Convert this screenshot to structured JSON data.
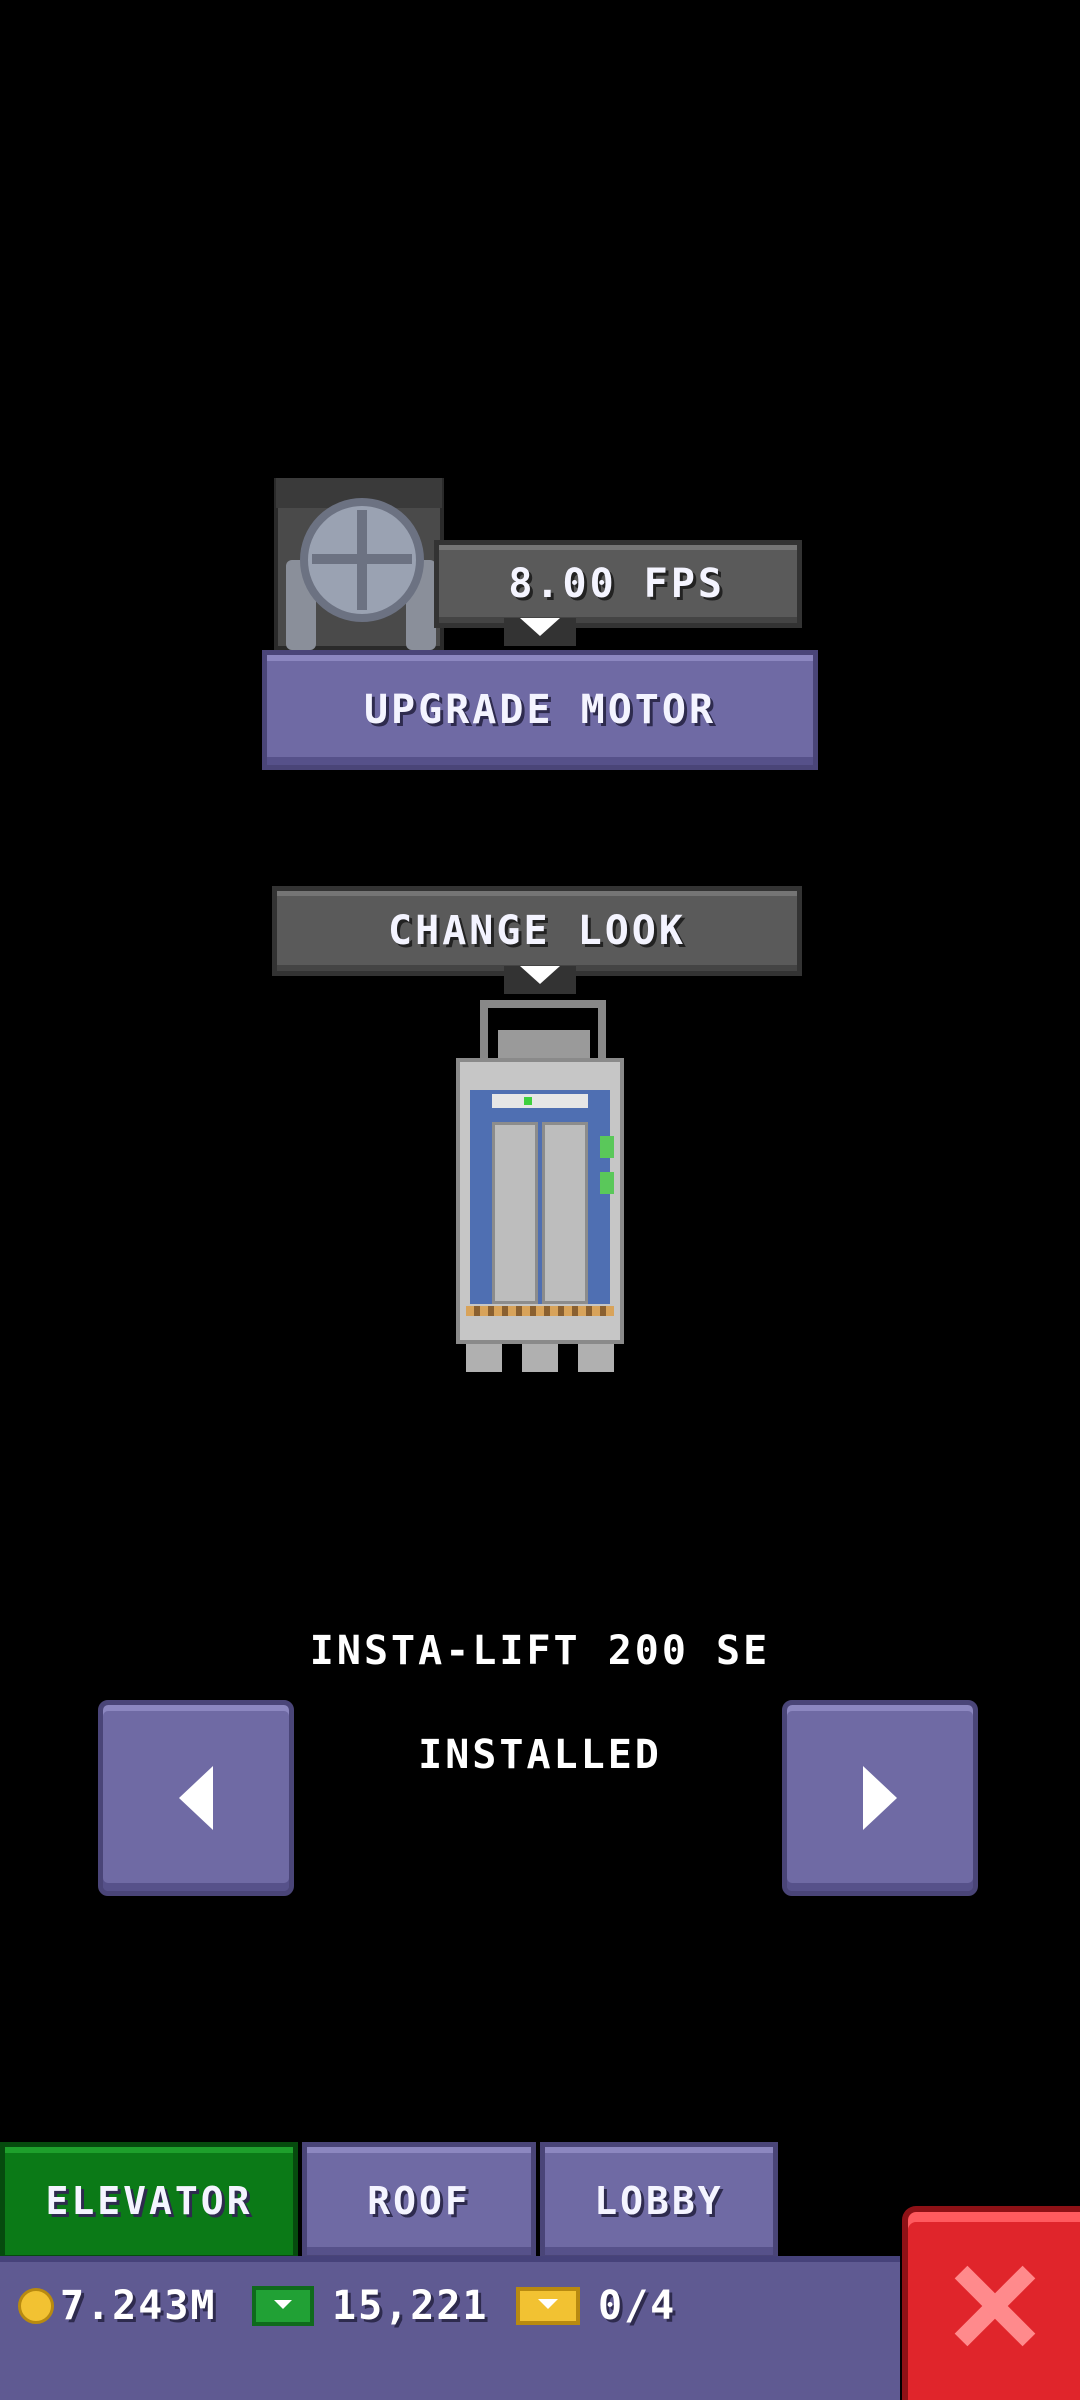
{
  "motor": {
    "speed_label": "8.00 FPS",
    "upgrade_label": "UPGRADE MOTOR"
  },
  "look": {
    "change_label": "CHANGE LOOK"
  },
  "elevator_model": {
    "name": "INSTA-LIFT 200 SE",
    "status": "INSTALLED"
  },
  "tabs": [
    {
      "label": "ELEVATOR",
      "active": true
    },
    {
      "label": "ROOF",
      "active": false
    },
    {
      "label": "LOBBY",
      "active": false
    }
  ],
  "currency": {
    "coins": "7.243M",
    "bux": "15,221",
    "tickets": "0/4"
  },
  "icons": {
    "coin": "coin-icon",
    "bux": "cash-icon",
    "tickets": "ticket-icon",
    "prev": "arrow-left-icon",
    "next": "arrow-right-icon",
    "close": "close-icon"
  },
  "colors": {
    "button_purple": "#6f6aa4",
    "active_tab_green": "#0b7a17",
    "close_red": "#e0252b"
  }
}
